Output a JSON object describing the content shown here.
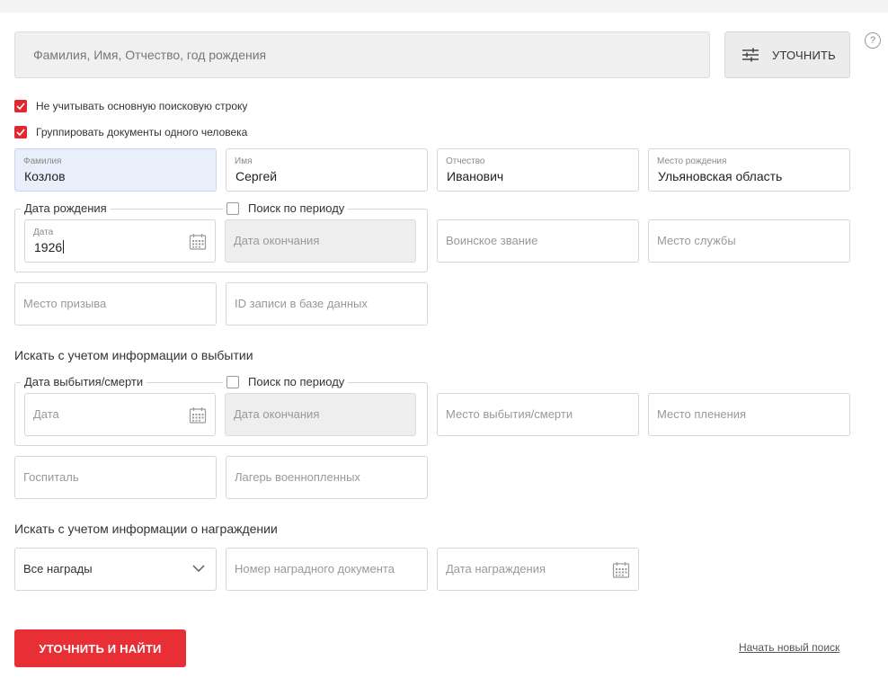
{
  "search": {
    "placeholder": "Фамилия, Имя, Отчество, год рождения",
    "refine_label": "УТОЧНИТЬ",
    "help_label": "?"
  },
  "options": {
    "ignore_main": "Не учитывать основную поисковую строку",
    "group_docs": "Группировать документы одного человека"
  },
  "person": {
    "surname_label": "Фамилия",
    "surname_value": "Козлов",
    "name_label": "Имя",
    "name_value": "Сергей",
    "patronymic_label": "Отчество",
    "patronymic_value": "Иванович",
    "birthplace_label": "Место рождения",
    "birthplace_value": "Ульяновская область"
  },
  "birth": {
    "legend": "Дата рождения",
    "period_label": "Поиск по периоду",
    "date_label": "Дата",
    "date_value": "1926",
    "end_placeholder": "Дата окончания",
    "rank_placeholder": "Воинское звание",
    "service_placeholder": "Место службы",
    "draft_placeholder": "Место призыва",
    "record_id_placeholder": "ID записи в базе данных"
  },
  "departure": {
    "title": "Искать с учетом информации о выбытии",
    "legend": "Дата выбытия/смерти",
    "period_label": "Поиск по периоду",
    "date_placeholder": "Дата",
    "end_placeholder": "Дата окончания",
    "place_placeholder": "Место выбытия/смерти",
    "captivity_placeholder": "Место пленения",
    "hospital_placeholder": "Госпиталь",
    "camp_placeholder": "Лагерь военнопленных"
  },
  "awards": {
    "title": "Искать с учетом информации о награждении",
    "select_value": "Все награды",
    "doc_number_placeholder": "Номер наградного документа",
    "award_date_placeholder": "Дата награждения"
  },
  "actions": {
    "submit_label": "УТОЧНИТЬ И НАЙТИ",
    "new_search_label": "Начать новый поиск"
  },
  "colors": {
    "accent": "#e82f36",
    "checkbox": "#e0282e",
    "highlight_field": "#e8effb"
  }
}
